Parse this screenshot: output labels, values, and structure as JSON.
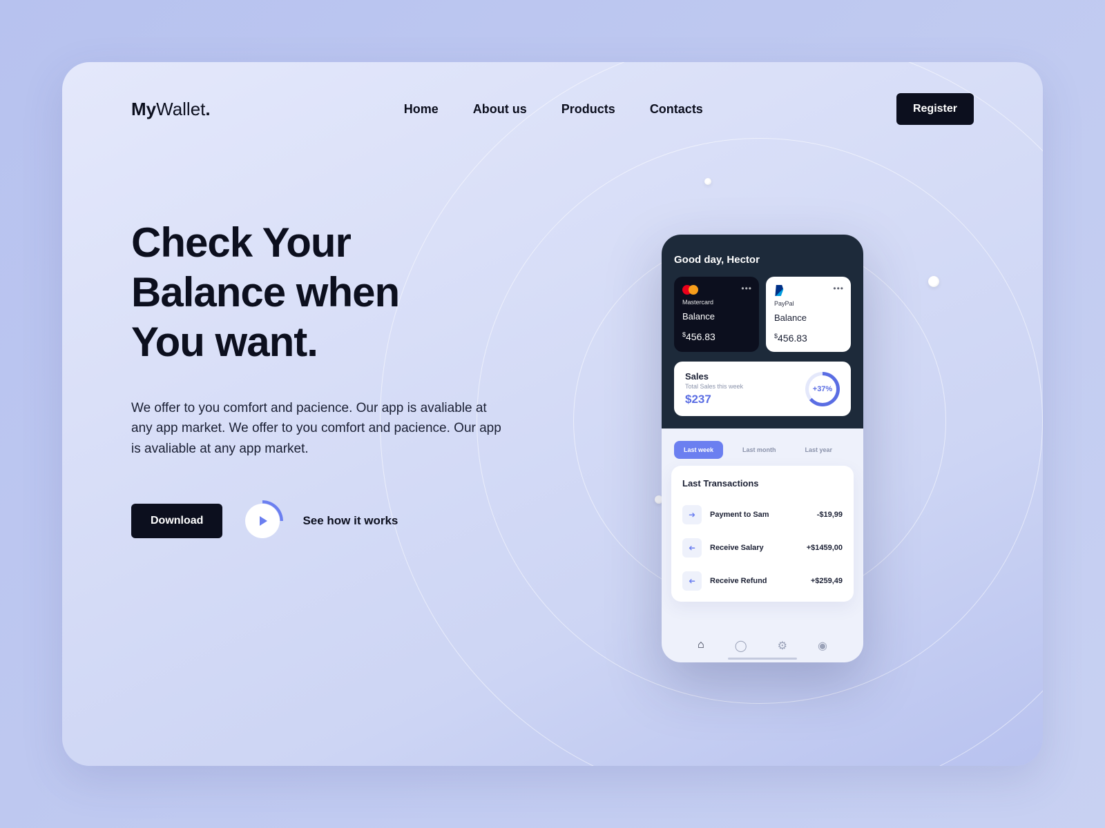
{
  "brand": {
    "bold": "My",
    "thin": "Wallet",
    "dot": "."
  },
  "nav": {
    "home": "Home",
    "about": "About us",
    "products": "Products",
    "contacts": "Contacts",
    "register": "Register"
  },
  "hero": {
    "headline_l1": "Check Your",
    "headline_l2": "Balance when",
    "headline_l3": "You want.",
    "subtext": "We offer to you comfort and pacience. Our app is avaliable at any app market. We offer to you comfort and pacience. Our app is avaliable at any app market.",
    "download": "Download",
    "how_it_works": "See how it works"
  },
  "phone": {
    "greeting": "Good day, Hector",
    "cards": [
      {
        "brand": "Mastercard",
        "balance_label": "Balance",
        "balance": "456.83"
      },
      {
        "brand": "PayPal",
        "balance_label": "Balance",
        "balance": "456.83"
      }
    ],
    "sales": {
      "title": "Sales",
      "subtitle": "Total Sales this week",
      "value": "$237",
      "delta": "+37%"
    },
    "tabs": {
      "week": "Last week",
      "month": "Last month",
      "year": "Last year"
    },
    "tx_title": "Last Transactions",
    "tx": [
      {
        "name": "Payment to Sam",
        "amount": "-$19,99",
        "dir": "out"
      },
      {
        "name": "Receive Salary",
        "amount": "+$1459,00",
        "dir": "in"
      },
      {
        "name": "Receive Refund",
        "amount": "+$259,49",
        "dir": "in"
      }
    ]
  }
}
